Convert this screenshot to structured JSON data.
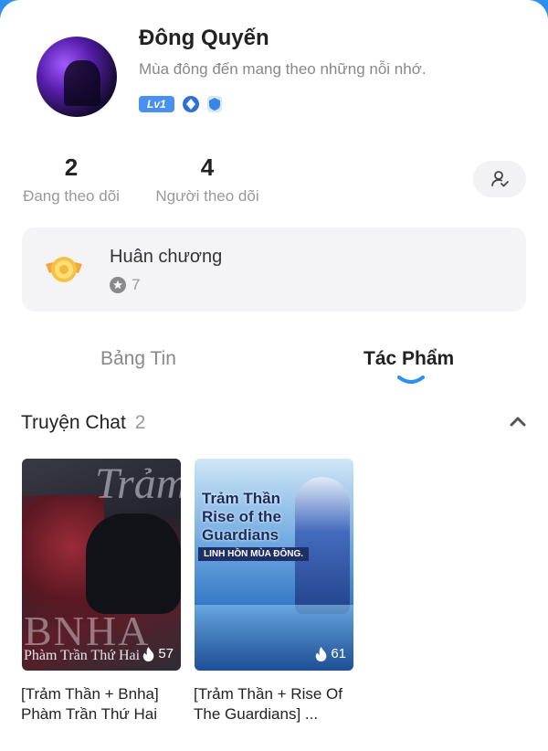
{
  "profile": {
    "name": "Đông Quyến",
    "bio": "Mùa đông đến mang theo những nỗi nhớ.",
    "level": "Lv1"
  },
  "stats": {
    "following_count": "2",
    "following_label": "Đang theo dõi",
    "followers_count": "4",
    "followers_label": "Người theo dõi"
  },
  "medals": {
    "title": "Huân chương",
    "count": "7"
  },
  "tabs": [
    {
      "label": "Bảng Tin",
      "active": false
    },
    {
      "label": "Tác Phẩm",
      "active": true
    }
  ],
  "section": {
    "title": "Truyện Chat",
    "count": "2"
  },
  "stories": [
    {
      "title": "[Trảm Thần + Bnha] Phàm Trần Thứ Hai",
      "cover_text_top": "Trảm",
      "cover_text_mid": "BNHA",
      "cover_text_bottom": "Phàm Trần Thứ Hai",
      "views": "57"
    },
    {
      "title": "[Trảm Thần + Rise Of The Guardians] ...",
      "cover_title": "Trảm Thần Rise of the Guardians",
      "cover_band": "LINH HỒN MÙA ĐÔNG.",
      "views": "61"
    }
  ],
  "colors": {
    "accent": "#2f8ff0",
    "level_badge": "#4a90f0",
    "tab_underline": "#2f8ff0"
  }
}
